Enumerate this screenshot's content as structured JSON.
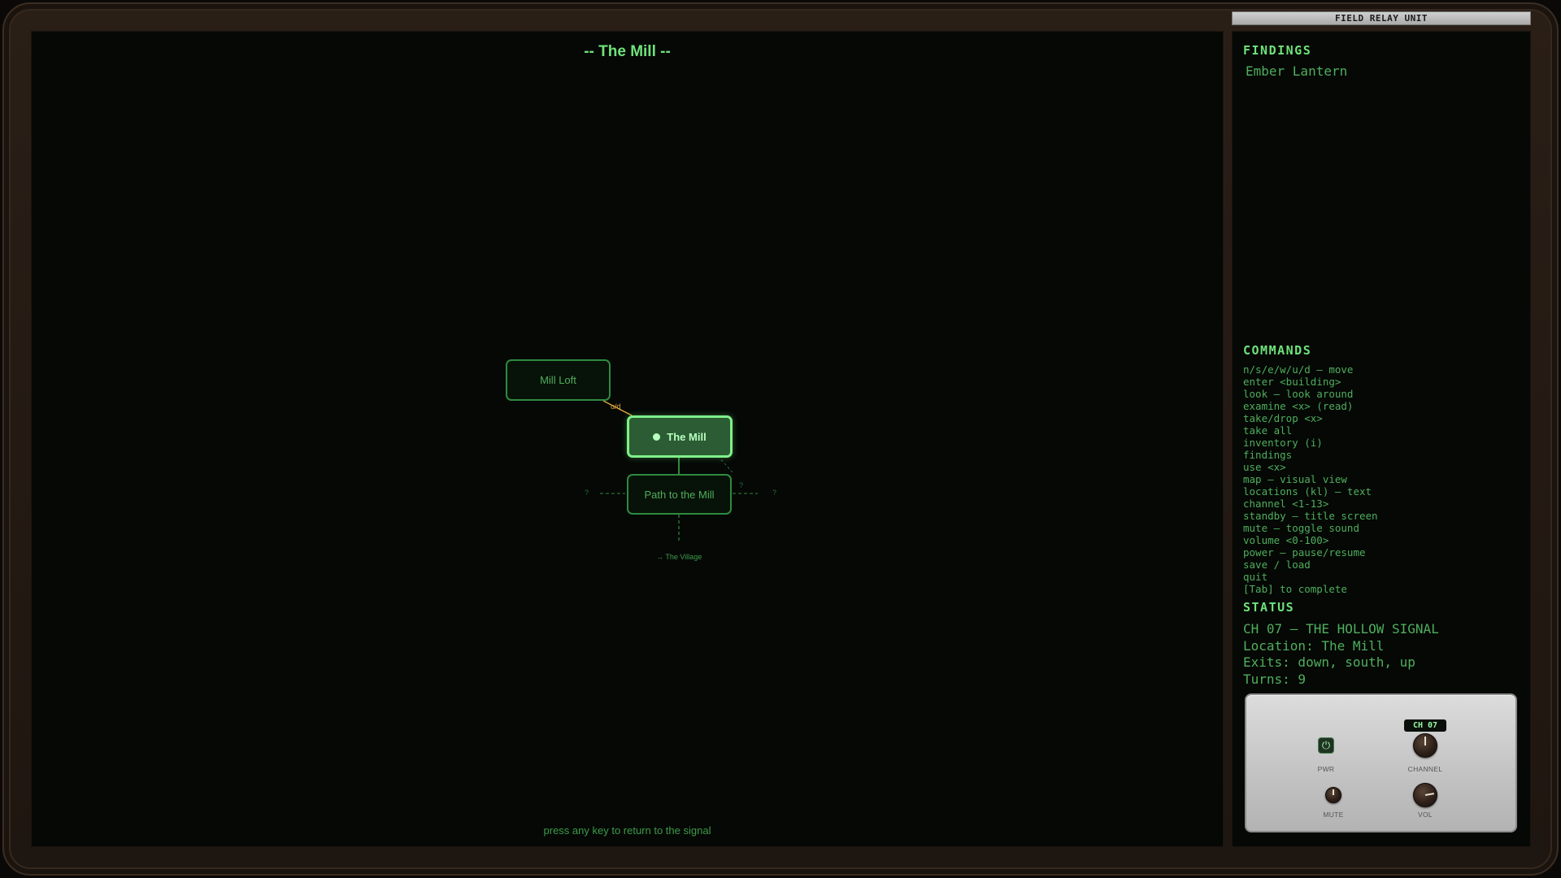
{
  "map": {
    "title": "-- The Mill --",
    "footer": "press any key to return to the signal",
    "rooms": {
      "mill_loft": "Mill Loft",
      "the_mill": "The Mill",
      "path_to_mill": "Path to the Mill"
    },
    "current_room": "The Mill",
    "up_down_marker": "u/d",
    "unknown_marker": "?",
    "exit_to": "→ The Village"
  },
  "panel": {
    "unit_label": "FIELD RELAY UNIT",
    "findings_title": "FINDINGS",
    "findings": [
      "Ember Lantern"
    ],
    "commands_title": "COMMANDS",
    "commands": [
      "n/s/e/w/u/d — move",
      "enter <building>",
      "look — look around",
      "examine <x> (read)",
      "take/drop <x>",
      "take all",
      "inventory (i)",
      "findings",
      "use <x>",
      "map — visual view",
      "locations (kl) — text",
      "channel <1-13>",
      "standby — title screen",
      "mute — toggle sound",
      "volume <0-100>",
      "power — pause/resume",
      "save / load",
      "quit",
      "[Tab] to complete"
    ],
    "status_title": "STATUS",
    "status": {
      "channel_line": "CH 07 — THE HOLLOW SIGNAL",
      "location_line": "Location: The Mill",
      "exits_line": "Exits: down, south, up",
      "turns_line": "Turns: 9"
    }
  },
  "console": {
    "channel_display": "CH 07",
    "pwr_label": "PWR",
    "channel_label": "CHANNEL",
    "mute_label": "MUTE",
    "vol_label": "VOL",
    "power_icon": "power-icon"
  }
}
